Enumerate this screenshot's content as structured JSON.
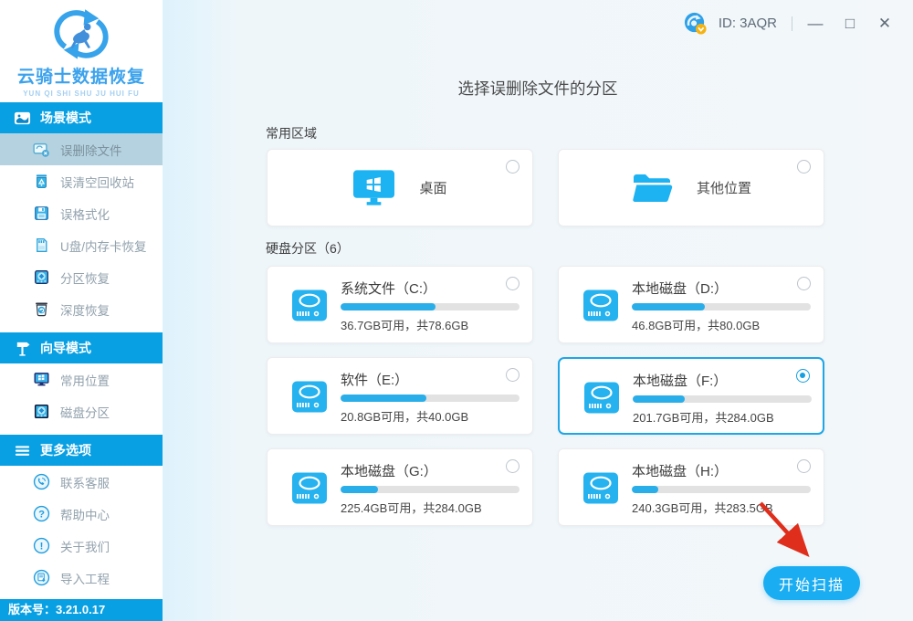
{
  "window": {
    "id_label": "ID: 3AQR",
    "controls": {
      "minimize": "—",
      "maximize": "□",
      "close": "✕"
    }
  },
  "sidebar": {
    "logo": {
      "title": "云骑士数据恢复",
      "subtitle": "YUN QI SHI SHU JU HUI FU"
    },
    "sections": [
      {
        "label": "场景模式",
        "icon": "scene-mode-icon",
        "items": [
          {
            "label": "误删除文件",
            "icon": "deleted-file-icon",
            "selected": true
          },
          {
            "label": "误清空回收站",
            "icon": "recycle-bin-icon",
            "selected": false
          },
          {
            "label": "误格式化",
            "icon": "format-icon",
            "selected": false
          },
          {
            "label": "U盘/内存卡恢复",
            "icon": "sdcard-icon",
            "selected": false
          },
          {
            "label": "分区恢复",
            "icon": "partition-icon",
            "selected": false
          },
          {
            "label": "深度恢复",
            "icon": "deep-recovery-icon",
            "selected": false
          }
        ]
      },
      {
        "label": "向导模式",
        "icon": "wizard-mode-icon",
        "items": [
          {
            "label": "常用位置",
            "icon": "monitor-icon",
            "selected": false
          },
          {
            "label": "磁盘分区",
            "icon": "disk-partition-icon",
            "selected": false
          }
        ]
      },
      {
        "label": "更多选项",
        "icon": "more-options-icon",
        "items": [
          {
            "label": "联系客服",
            "icon": "contact-support-icon",
            "selected": false
          },
          {
            "label": "帮助中心",
            "icon": "help-center-icon",
            "selected": false
          },
          {
            "label": "关于我们",
            "icon": "about-us-icon",
            "selected": false
          },
          {
            "label": "导入工程",
            "icon": "import-project-icon",
            "selected": false
          }
        ]
      }
    ],
    "version": "版本号：3.21.0.17"
  },
  "main": {
    "title": "选择误删除文件的分区",
    "common_section": {
      "label": "常用区域",
      "cards": [
        {
          "label": "桌面",
          "icon": "desktop-icon",
          "selected": false
        },
        {
          "label": "其他位置",
          "icon": "folder-icon",
          "selected": false
        }
      ]
    },
    "partitions_section": {
      "label": "硬盘分区（6）",
      "drives": [
        {
          "name": "系统文件（C:）",
          "usage": "36.7GB可用，共78.6GB",
          "used_percent": 53,
          "selected": false
        },
        {
          "name": "本地磁盘（D:）",
          "usage": "46.8GB可用，共80.0GB",
          "used_percent": 41,
          "selected": false
        },
        {
          "name": "软件（E:）",
          "usage": "20.8GB可用，共40.0GB",
          "used_percent": 48,
          "selected": false
        },
        {
          "name": "本地磁盘（F:）",
          "usage": "201.7GB可用，共284.0GB",
          "used_percent": 29,
          "selected": true
        },
        {
          "name": "本地磁盘（G:）",
          "usage": "225.4GB可用，共284.0GB",
          "used_percent": 21,
          "selected": false
        },
        {
          "name": "本地磁盘（H:）",
          "usage": "240.3GB可用，共283.5GB",
          "used_percent": 15,
          "selected": false
        }
      ]
    },
    "scan_button": "开始扫描"
  },
  "colors": {
    "accent_blue": "#09a0e3",
    "button_blue": "#1badf2",
    "icon_blue": "#25b2ef",
    "progress_fill": "#29aee9",
    "progress_track": "#e2e2e2",
    "selected_border": "#1ea6e6",
    "selected_sidebar_bg": "#b5d2e0",
    "arrow_red": "#df2e1c",
    "badge_yellow": "#f5b312"
  }
}
